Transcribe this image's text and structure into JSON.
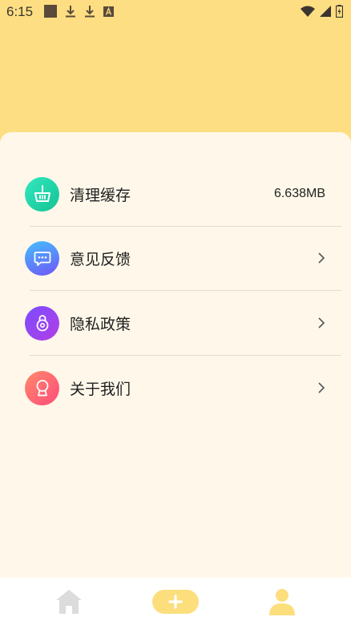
{
  "status_bar": {
    "time": "6:15"
  },
  "settings": {
    "items": [
      {
        "label": "清理缓存",
        "value": "6.638MB",
        "icon": "broom-basket-icon",
        "color_from": "#2fe0b6",
        "color_to": "#18c59c"
      },
      {
        "label": "意见反馈",
        "icon": "chat-bubble-icon",
        "color_from": "#4fb2ff",
        "color_to": "#6a5cf6"
      },
      {
        "label": "隐私政策",
        "icon": "lock-icon",
        "color_from": "#8f4dff",
        "color_to": "#b23ee6"
      },
      {
        "label": "关于我们",
        "icon": "badge-icon",
        "color_from": "#ff7a6b",
        "color_to": "#ff4d7d"
      }
    ]
  },
  "bottom_nav": {
    "items": [
      {
        "icon": "home-icon"
      },
      {
        "icon": "add-icon"
      },
      {
        "icon": "profile-icon"
      }
    ]
  },
  "colors": {
    "header_bg": "#fdde82",
    "card_bg": "#fff8ea",
    "accent": "#fddd7d"
  }
}
